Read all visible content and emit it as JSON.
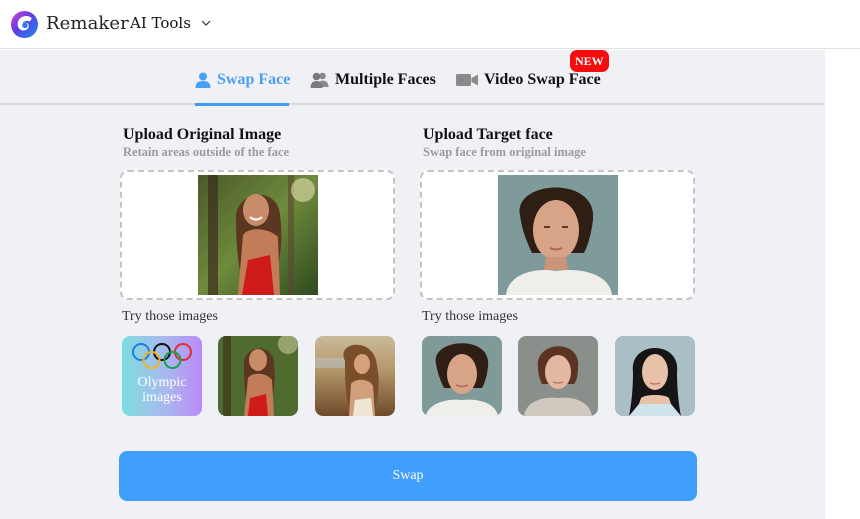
{
  "header": {
    "brand": "Remaker",
    "ai_tools_label": "AI Tools",
    "logo_icon": "remaker-swirl-logo",
    "dropdown_icon": "chevron-down-icon"
  },
  "tabs": [
    {
      "label": "Swap Face",
      "icon": "user-icon",
      "active": true
    },
    {
      "label": "Multiple Faces",
      "icon": "users-icon",
      "active": false
    },
    {
      "label": "Video Swap Face",
      "icon": "video-camera-icon",
      "active": false,
      "badge": "NEW"
    }
  ],
  "colors": {
    "accent": "#409ffd",
    "active_tab": "#4a9ff5",
    "badge": "#f40d0d",
    "background": "#f0f1f5",
    "subtitle": "#9b9b9b"
  },
  "original": {
    "title": "Upload Original Image",
    "subtitle": "Retain areas outside of the face",
    "preview": "woman in red top in tropical forest",
    "try_label": "Try those images",
    "samples": [
      {
        "kind": "olympic",
        "label_line1": "Olympic",
        "label_line2": "images"
      },
      {
        "kind": "photo",
        "alt": "woman in red top in forest"
      },
      {
        "kind": "photo",
        "alt": "woman with windswept hair at sunset"
      }
    ]
  },
  "target": {
    "title": "Upload Target face",
    "subtitle": "Swap face from original image",
    "preview": "man with curly hair portrait",
    "try_label": "Try those images",
    "samples": [
      {
        "kind": "photo",
        "alt": "man with curly hair"
      },
      {
        "kind": "photo",
        "alt": "young woman with hair bun"
      },
      {
        "kind": "photo",
        "alt": "asian woman with long black hair"
      }
    ]
  },
  "swap_button": {
    "label": "Swap"
  }
}
